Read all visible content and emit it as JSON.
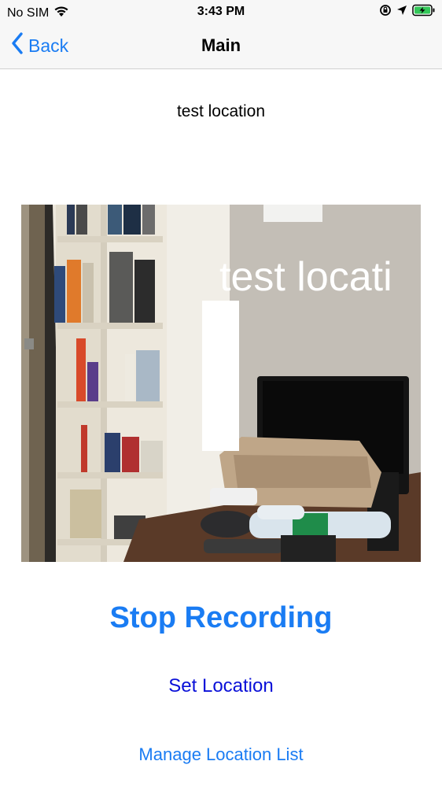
{
  "status_bar": {
    "carrier": "No SIM",
    "time": "3:43 PM",
    "icons": [
      "wifi-icon",
      "orientation-lock-icon",
      "location-arrow-icon",
      "battery-charging-icon"
    ]
  },
  "nav": {
    "back_label": "Back",
    "title": "Main"
  },
  "location_name": "test location",
  "camera": {
    "overlay_text": "test locati"
  },
  "actions": {
    "stop_recording": "Stop Recording",
    "set_location": "Set Location",
    "manage_location_list": "Manage Location List"
  },
  "colors": {
    "accent": "#1a7cf3",
    "set_location": "#0a10d8"
  }
}
